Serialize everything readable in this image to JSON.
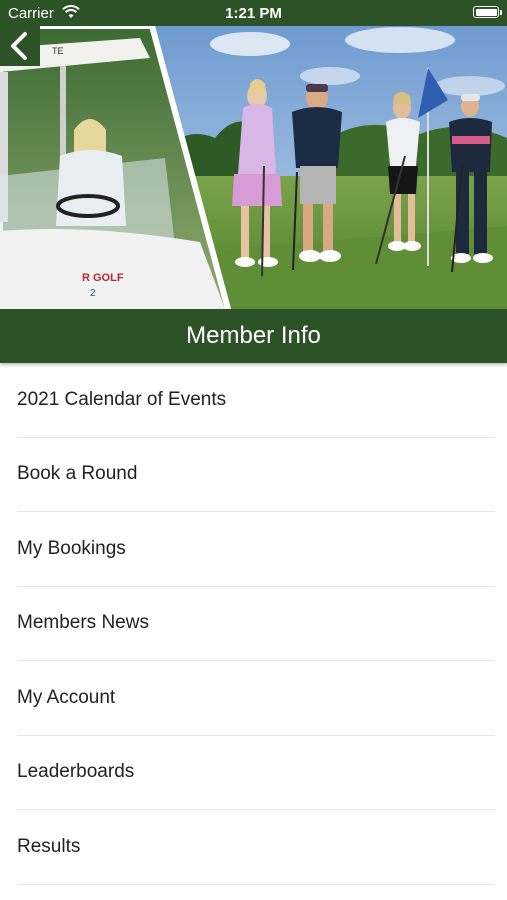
{
  "status_bar": {
    "carrier": "Carrier",
    "time": "1:21 PM",
    "icons": [
      "wifi-icon",
      "battery-icon"
    ]
  },
  "header": {
    "back_icon": "chevron-left-icon",
    "title": "Member Info",
    "hero_image": "golfers-on-putting-green",
    "cart_logo_text": "R GOLF"
  },
  "menu": {
    "items": [
      {
        "label": "2021 Calendar of Events"
      },
      {
        "label": "Book a Round"
      },
      {
        "label": "My Bookings"
      },
      {
        "label": "Members News"
      },
      {
        "label": "My Account"
      },
      {
        "label": "Leaderboards"
      },
      {
        "label": "Results"
      }
    ]
  },
  "colors": {
    "brand_green": "#2e5227",
    "text": "#222222",
    "divider": "#e6e6e6"
  }
}
